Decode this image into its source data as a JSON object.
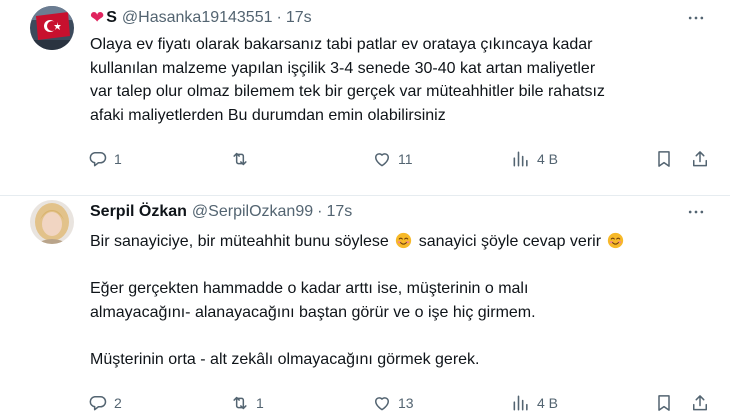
{
  "tweets": [
    {
      "display_name": "S",
      "handle": "@Hasanka19143551",
      "separator": "·",
      "time": "17s",
      "lines": [
        "Olaya ev fiyatı olarak bakarsanız tabi patlar ev orataya çıkıncaya kadar",
        "kullanılan malzeme yapılan işçilik 3-4 senede 30-40 kat artan maliyetler",
        "var talep olur olmaz bilemem tek bir gerçek var müteahhitler bile rahatsız",
        "afaki maliyetlerden Bu durumdan emin olabilirsiniz"
      ],
      "replies": "1",
      "reposts": "",
      "likes": "11",
      "views": "4 B"
    },
    {
      "display_name": "Serpil Özkan",
      "handle": "@SerpilOzkan99",
      "separator": "·",
      "time": "17s",
      "line1_a": "Bir sanayiciye,  bir müteahhit bunu söylese",
      "line1_b": "sanayici şöyle cevap verir",
      "line2": "Eğer gerçekten hammadde o kadar arttı ise, müşterinin o malı",
      "line3": "almayacağını- alanayacağını baştan görür ve o işe hiç girmem.",
      "line4": "Müşterinin orta - alt zekâlı olmayacağını  görmek gerek.",
      "replies": "2",
      "reposts": "1",
      "likes": "13",
      "views": "4 B"
    }
  ],
  "colors": {
    "text": "#0f1419",
    "muted": "#536471",
    "heart": "#e0245e",
    "divider": "#e6ecf0"
  },
  "icons": [
    "heart-emoji-icon",
    "more-icon",
    "reply-icon",
    "repost-icon",
    "like-icon",
    "views-icon",
    "bookmark-icon",
    "share-icon",
    "smiling-face-emoji-icon"
  ]
}
